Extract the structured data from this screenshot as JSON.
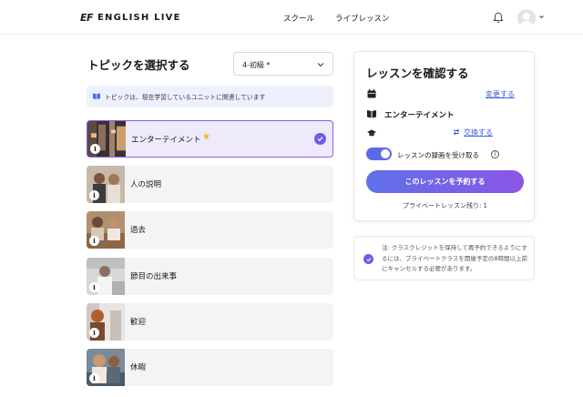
{
  "header": {
    "logo_mark": "EF",
    "logo_text": "ENGLISH LIVE",
    "nav": [
      "スクール",
      "ライブレッスン"
    ]
  },
  "topics": {
    "title": "トピックを選択する",
    "level_select": {
      "value": "4-初級 *"
    },
    "info": "トピックは、現在学習しているユニットに関連しています",
    "items": [
      {
        "label": "エンターテイメント",
        "selected": true,
        "starred": true
      },
      {
        "label": "人の説明",
        "selected": false,
        "starred": false
      },
      {
        "label": "過去",
        "selected": false,
        "starred": false
      },
      {
        "label": "節目の出来事",
        "selected": false,
        "starred": false
      },
      {
        "label": "歓迎",
        "selected": false,
        "starred": false
      },
      {
        "label": "休暇",
        "selected": false,
        "starred": false
      }
    ]
  },
  "confirm": {
    "title": "レッスンを確認する",
    "change_link": "変更する",
    "topic_value": "エンターテイメント",
    "swap_link": "交換する",
    "record_label": "レッスンの録画を受け取る",
    "record_enabled": true,
    "book_button": "このレッスンを予約する",
    "remaining": "プライベートレッスン残り: 1"
  },
  "note": {
    "text": "注: クラスクレジットを保持して再予約できるようにするには、プライベートクラスを開催予定の8時間以上前にキャンセルする必要があります。"
  },
  "colors": {
    "accent": "#6e5ce6",
    "link": "#3b5bdb",
    "selected_bg": "#eee9fb",
    "star": "#f5b700"
  }
}
